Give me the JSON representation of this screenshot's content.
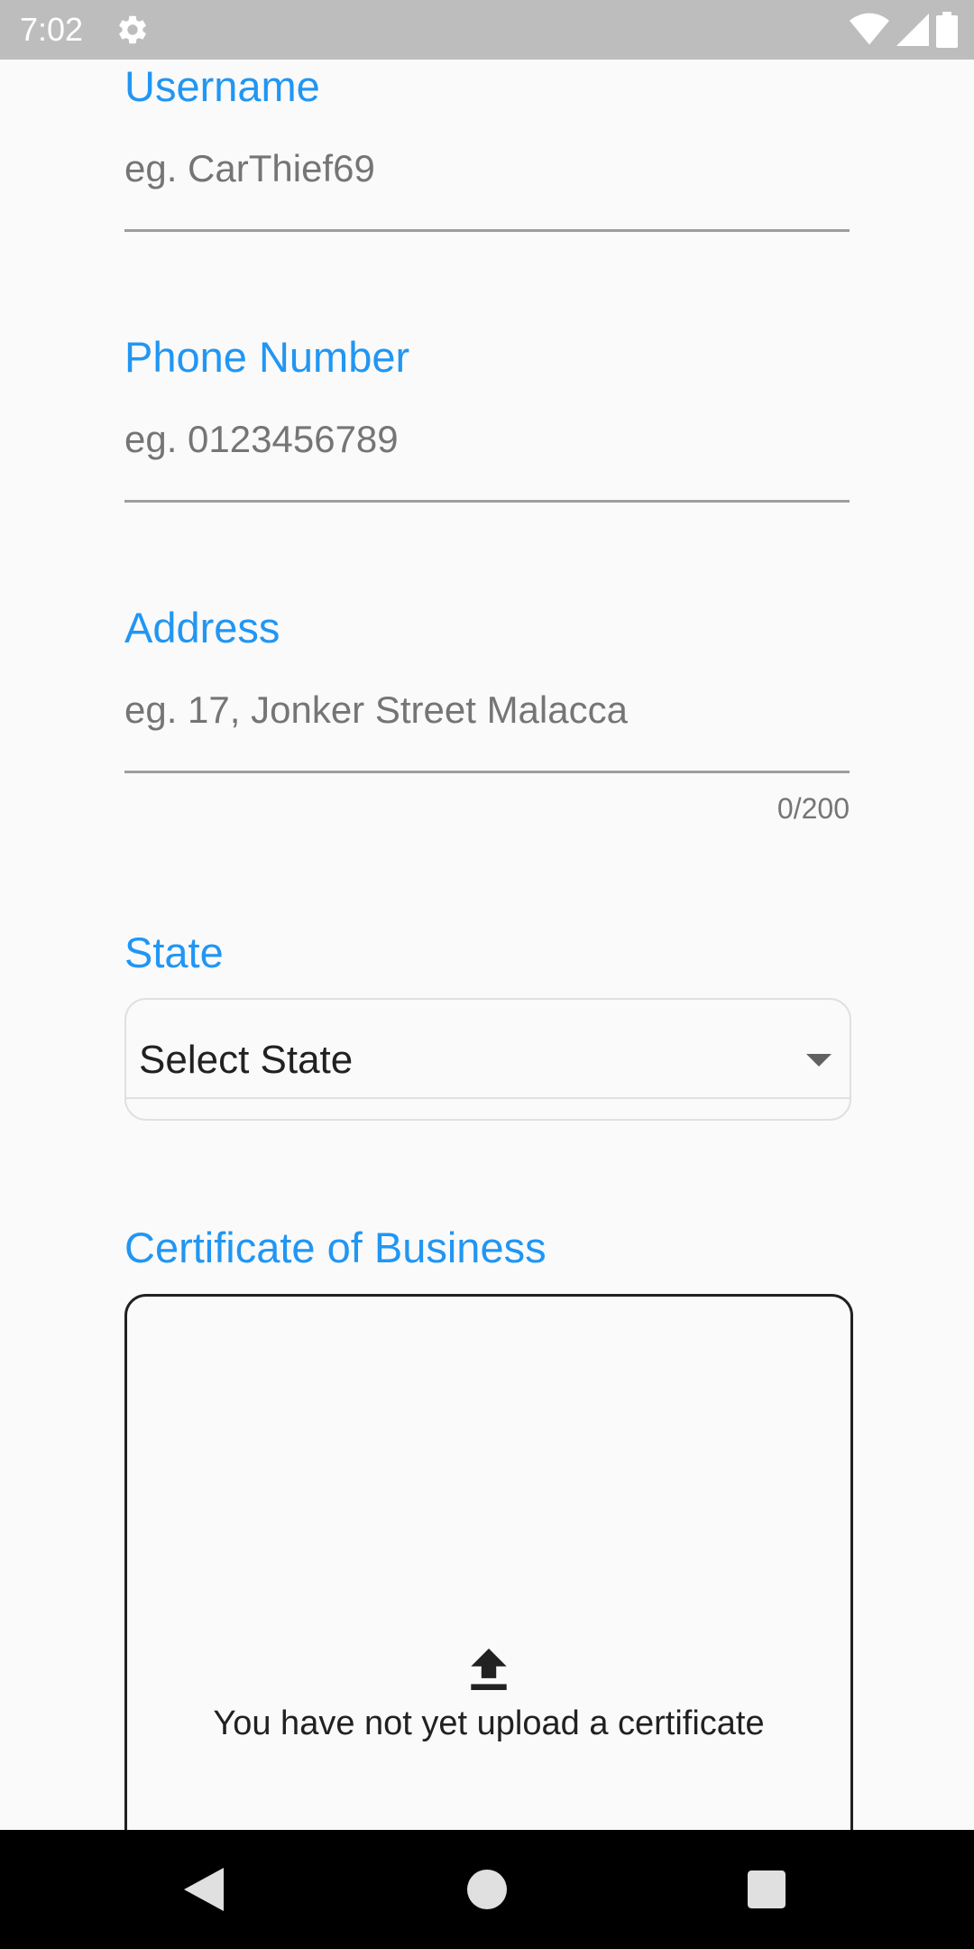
{
  "status_bar": {
    "time": "7:02",
    "icons": [
      "gear-icon",
      "wifi-icon",
      "signal-icon",
      "battery-icon"
    ]
  },
  "form": {
    "username": {
      "label": "Username",
      "placeholder": "eg. CarThief69"
    },
    "phone": {
      "label": "Phone Number",
      "placeholder": "eg. 0123456789"
    },
    "address": {
      "label": "Address",
      "placeholder": "eg. 17, Jonker Street Malacca",
      "counter": "0/200"
    },
    "state": {
      "label": "State",
      "selected": "Select State"
    },
    "certificate": {
      "label": "Certificate of Business",
      "empty_text": "You have not yet upload a certificate",
      "icon": "upload-icon"
    }
  },
  "nav_bar": {
    "icons": [
      "back-icon",
      "home-icon",
      "recents-icon"
    ]
  },
  "colors": {
    "accent": "#2196f3",
    "status_bar": "#bdbdbd",
    "nav_bar": "#000000"
  }
}
